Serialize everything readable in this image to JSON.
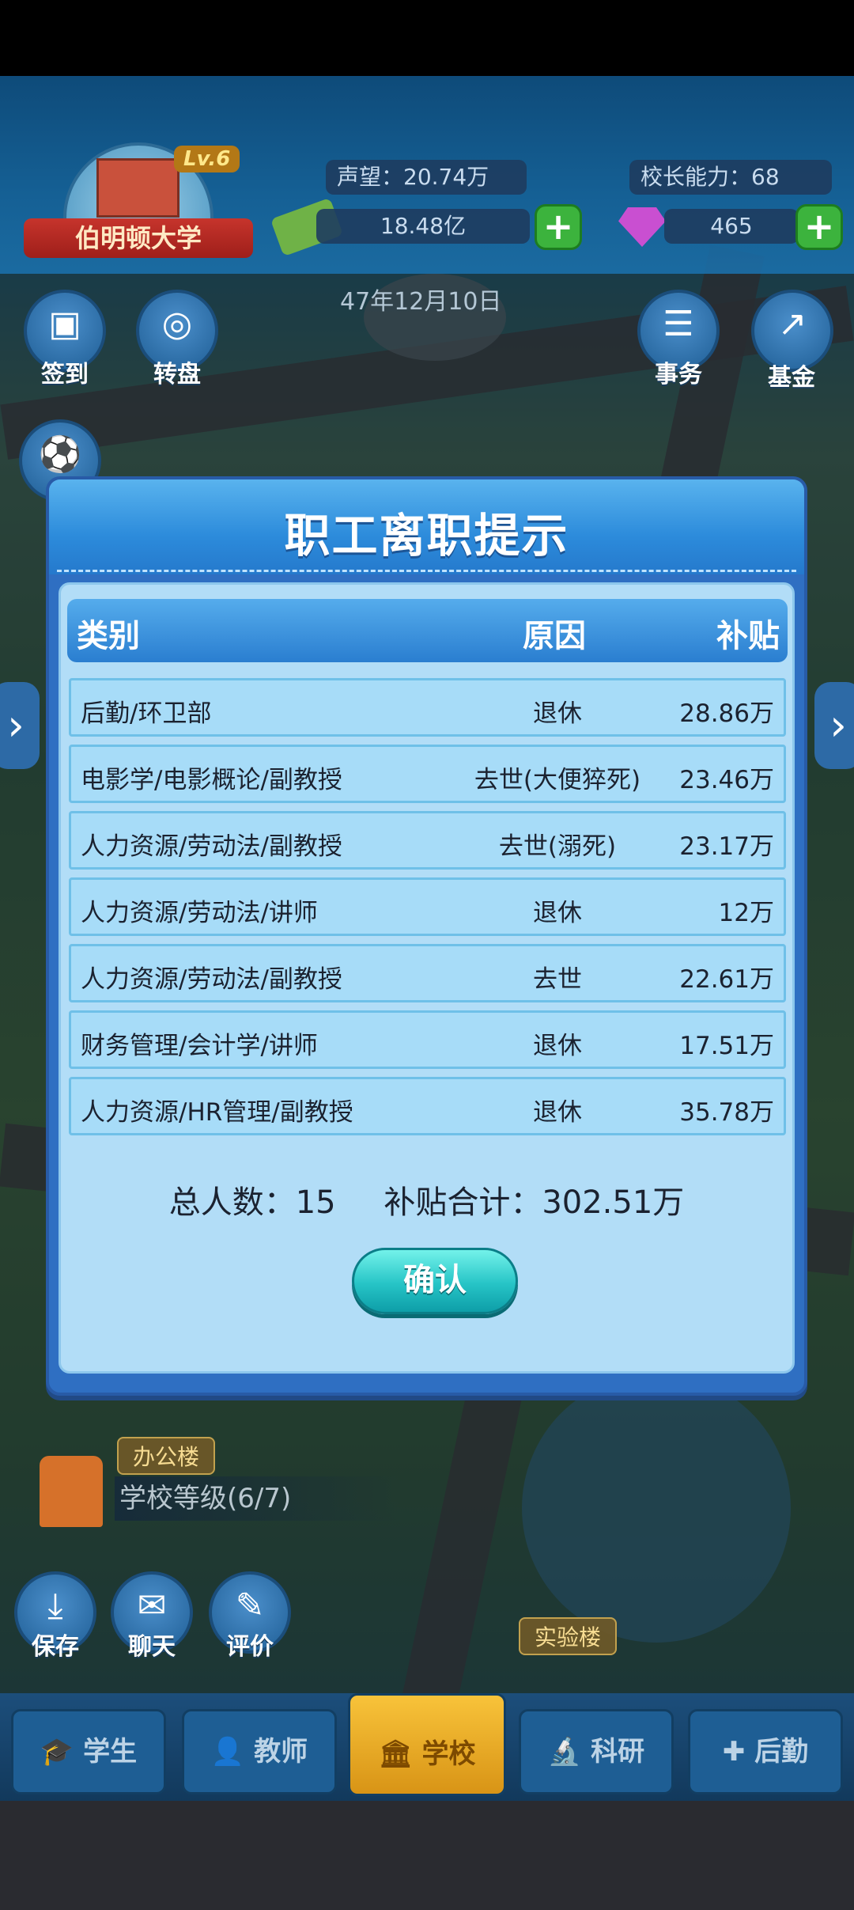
{
  "hud": {
    "school_level": "Lv.6",
    "school_name": "伯明顿大学",
    "reputation": "声望：20.74万",
    "principal_ability": "校长能力：68",
    "money": "18.48亿",
    "gems": "465",
    "date": "47年12月10日"
  },
  "side_buttons": {
    "signin": "签到",
    "wheel": "转盘",
    "affairs": "事务",
    "fund": "基金",
    "save": "保存",
    "chat": "聊天",
    "review": "评价"
  },
  "map_labels": {
    "office": "办公楼",
    "school_level": "学校等级(6/7)",
    "lab": "实验楼"
  },
  "nav": {
    "students": "学生",
    "teachers": "教师",
    "school": "学校",
    "research": "科研",
    "logistics": "后勤"
  },
  "dialog": {
    "title": "职工离职提示",
    "headers": {
      "category": "类别",
      "reason": "原因",
      "subsidy": "补贴"
    },
    "rows": [
      {
        "category": "后勤/环卫部",
        "reason": "退休",
        "subsidy": "28.86万"
      },
      {
        "category": "电影学/电影概论/副教授",
        "reason": "去世(大便猝死)",
        "subsidy": "23.46万"
      },
      {
        "category": "人力资源/劳动法/副教授",
        "reason": "去世(溺死)",
        "subsidy": "23.17万"
      },
      {
        "category": "人力资源/劳动法/讲师",
        "reason": "退休",
        "subsidy": "12万"
      },
      {
        "category": "人力资源/劳动法/副教授",
        "reason": "去世",
        "subsidy": "22.61万"
      },
      {
        "category": "财务管理/会计学/讲师",
        "reason": "退休",
        "subsidy": "17.51万"
      },
      {
        "category": "人力资源/HR管理/副教授",
        "reason": "退休",
        "subsidy": "35.78万"
      }
    ],
    "total_count": "总人数：15",
    "total_subsidy": "补贴合计：302.51万",
    "confirm": "确认"
  }
}
